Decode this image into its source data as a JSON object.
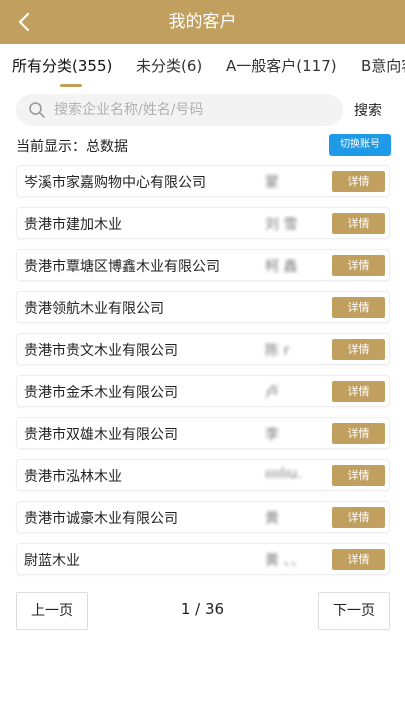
{
  "header": {
    "title": "我的客户"
  },
  "tabs": [
    {
      "label": "所有分类(355)"
    },
    {
      "label": "未分类(6)"
    },
    {
      "label": "A一般客户(117)"
    },
    {
      "label": "B意向客户"
    }
  ],
  "search": {
    "placeholder": "搜索企业名称/姓名/号码",
    "button_label": "搜索"
  },
  "current": {
    "text": "当前显示：总数据"
  },
  "switch_account": {
    "label": "切换账号"
  },
  "customers": [
    {
      "company": "岑溪市家嘉购物中心有限公司",
      "contact": "蒙",
      "detail_label": "详情"
    },
    {
      "company": "贵港市建加木业",
      "contact": "刘 雪",
      "detail_label": "详情"
    },
    {
      "company": "贵港市覃塘区博鑫木业有限公司",
      "contact": "柯 鑫",
      "detail_label": "详情"
    },
    {
      "company": "贵港领航木业有限公司",
      "contact": "",
      "detail_label": "详情"
    },
    {
      "company": "贵港市贵文木业有限公司",
      "contact": "陈 r",
      "detail_label": "详情"
    },
    {
      "company": "贵港市金禾木业有限公司",
      "contact": "卢",
      "detail_label": "详情"
    },
    {
      "company": "贵港市双雄木业有限公司",
      "contact": "李",
      "detail_label": "详情"
    },
    {
      "company": "贵港市泓林木业",
      "contact": "ıııılıu.",
      "detail_label": "详情"
    },
    {
      "company": "贵港市诚豪木业有限公司",
      "contact": "黄",
      "detail_label": "详情"
    },
    {
      "company": "尉蓝木业",
      "contact": "黄 、、",
      "detail_label": "详情"
    }
  ],
  "pager": {
    "prev_label": "上一页",
    "next_label": "下一页",
    "page_info": "1 / 36"
  },
  "colors": {
    "header": "#c1a05f",
    "detail_button": "#c1a05f",
    "switch_button": "#1f9ae6"
  }
}
